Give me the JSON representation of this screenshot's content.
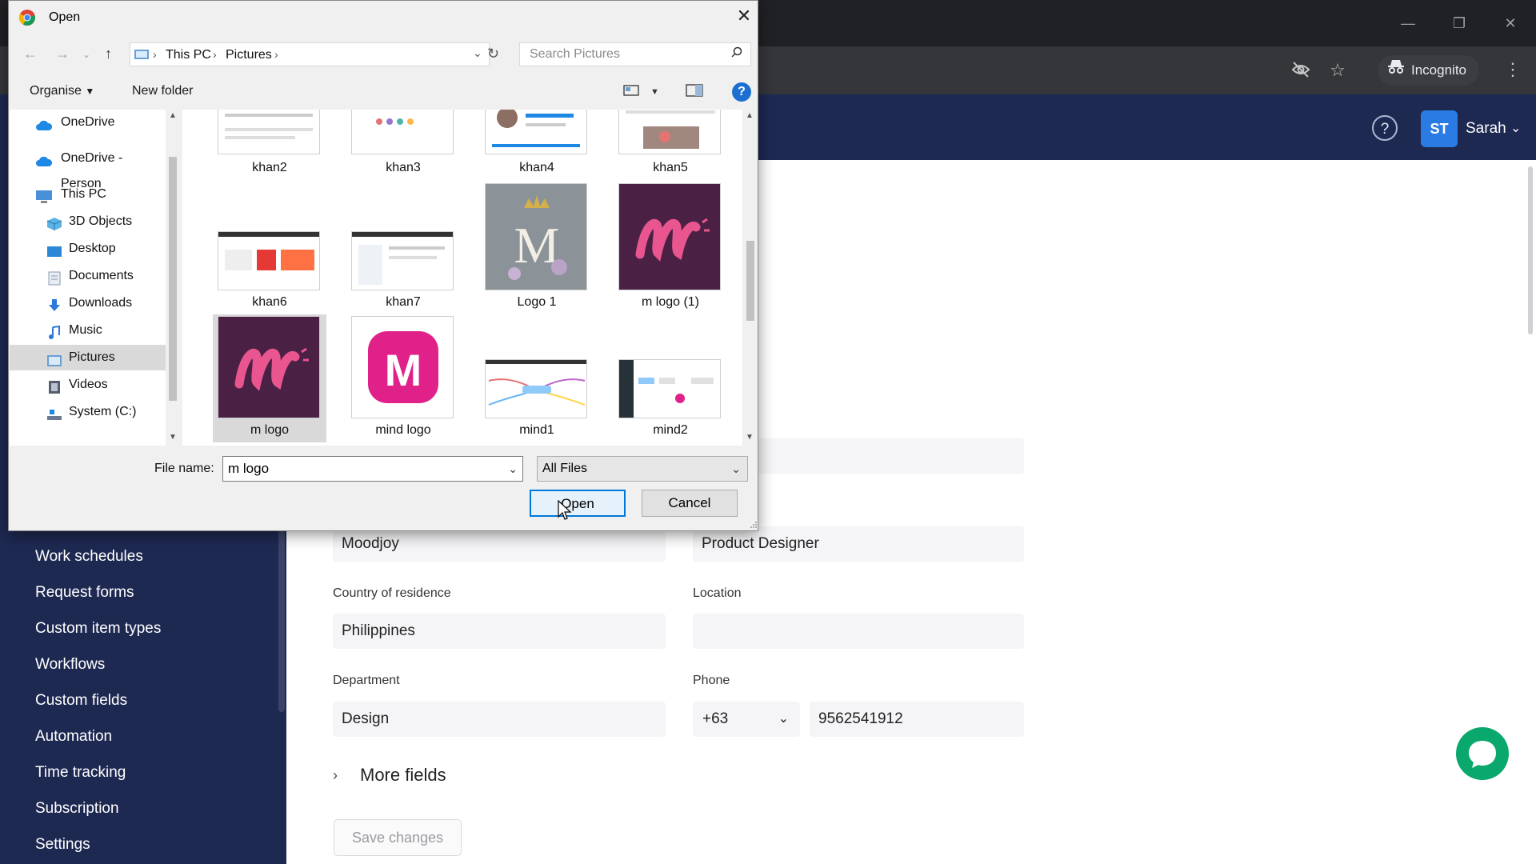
{
  "browser": {
    "incognito_label": "Incognito"
  },
  "header": {
    "avatar_initials": "ST",
    "user_name": "Sarah"
  },
  "sidebar": {
    "items": [
      {
        "label": "Work schedules"
      },
      {
        "label": "Request forms"
      },
      {
        "label": "Custom item types"
      },
      {
        "label": "Workflows"
      },
      {
        "label": "Custom fields"
      },
      {
        "label": "Automation"
      },
      {
        "label": "Time tracking"
      },
      {
        "label": "Subscription"
      },
      {
        "label": "Settings"
      }
    ]
  },
  "form": {
    "company_value": "Moodjoy",
    "job_title_value": "Product Designer",
    "country_label": "Country of residence",
    "country_value": "Philippines",
    "location_label": "Location",
    "location_value": "",
    "department_label": "Department",
    "department_value": "Design",
    "phone_label": "Phone",
    "phone_code": "+63",
    "phone_number": "9562541912",
    "more_fields": "More fields",
    "save_changes": "Save changes"
  },
  "dialog": {
    "title": "Open",
    "breadcrumb": [
      "This PC",
      "Pictures"
    ],
    "search_placeholder": "Search Pictures",
    "organise": "Organise",
    "new_folder": "New folder",
    "nav_items": [
      {
        "label": "OneDrive",
        "icon": "cloud-icon",
        "color": "#1e88e5"
      },
      {
        "label": "OneDrive - Person",
        "icon": "cloud-icon",
        "color": "#1e88e5"
      },
      {
        "label": "This PC",
        "icon": "computer-icon",
        "color": "#4a90d9"
      },
      {
        "label": "3D Objects",
        "icon": "cube-icon",
        "color": "#5bb3e6"
      },
      {
        "label": "Desktop",
        "icon": "desktop-icon",
        "color": "#2b88d8"
      },
      {
        "label": "Documents",
        "icon": "document-icon",
        "color": "#8a9bb0"
      },
      {
        "label": "Downloads",
        "icon": "download-icon",
        "color": "#2b79d8"
      },
      {
        "label": "Music",
        "icon": "music-icon",
        "color": "#2b79d8"
      },
      {
        "label": "Pictures",
        "icon": "pictures-icon",
        "color": "#6a9fd4"
      },
      {
        "label": "Videos",
        "icon": "video-icon",
        "color": "#555e6e"
      },
      {
        "label": "System (C:)",
        "icon": "drive-icon",
        "color": "#6b7a8f"
      }
    ],
    "files": [
      {
        "name": "khan2"
      },
      {
        "name": "khan3"
      },
      {
        "name": "khan4"
      },
      {
        "name": "khan5"
      },
      {
        "name": "khan6"
      },
      {
        "name": "khan7"
      },
      {
        "name": "Logo 1"
      },
      {
        "name": "m logo (1)"
      },
      {
        "name": "m logo"
      },
      {
        "name": "mind  logo"
      },
      {
        "name": "mind1"
      },
      {
        "name": "mind2"
      }
    ],
    "file_name_label": "File name:",
    "file_name_value": "m logo",
    "file_type": "All Files",
    "open_button": "Open",
    "cancel_button": "Cancel"
  }
}
